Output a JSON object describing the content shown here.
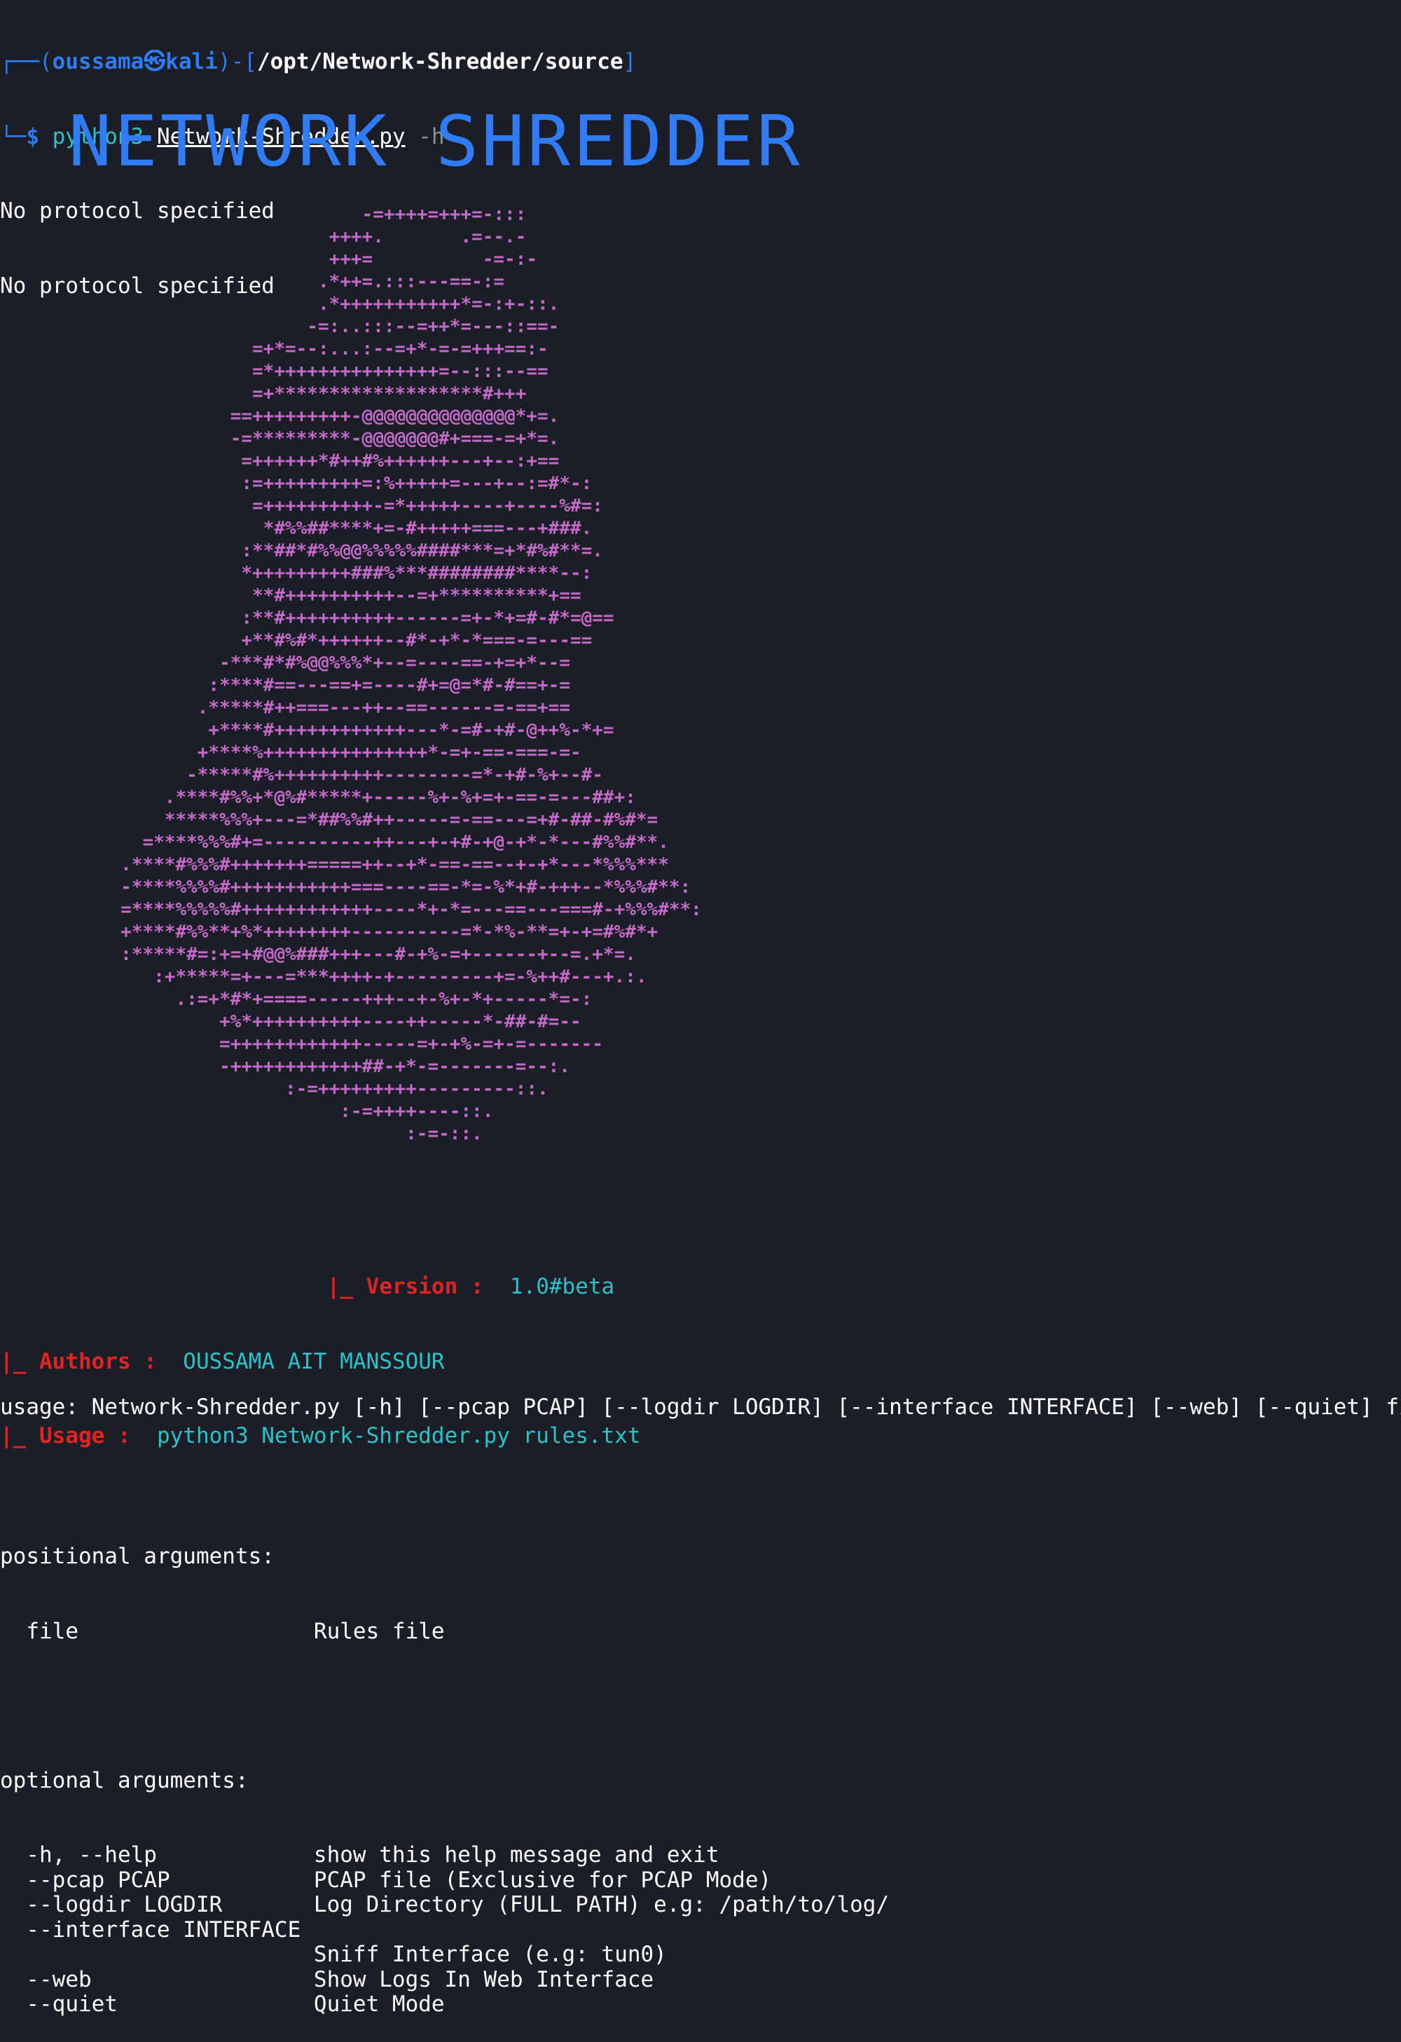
{
  "prompt": {
    "user_host": "oussama㉿kali",
    "cwd": "/opt/Network-Shredder/source",
    "cmd_prefix": "python3",
    "cmd_file": "Network-Shredder.py",
    "cmd_args": "-h"
  },
  "output_lines": [
    "No protocol specified",
    "No protocol specified"
  ],
  "banner_title": "NETWORK SHREDDER",
  "ascii_art": [
    "                                 -=++++=+++=-:::",
    "                              ++++.       .=--.-",
    "                              +++=          -=-:-",
    "                             .*++=.:::---==-:=",
    "                             .*+++++++++++*=-:+-::.",
    "                            -=:..:::--=++*=---::==-",
    "                       =+*=--:...:--=+*-=-=+++==:-",
    "                       =*+++++++++++++++=--:::--==",
    "                       =+*******************#+++",
    "                     ==+++++++++-@@@@@@@@@@@@@@*+=.",
    "                     -=*********-@@@@@@@#+===-=+*=.",
    "                      =++++++*#++#%++++++---+--:+==",
    "                      :=+++++++++=:%+++++=---+--:=#*-:",
    "                       =++++++++++-=*+++++----+----%#=:",
    "                        *#%%##****+=-#+++++===---+###.",
    "                      :**##*#%%@@%%%%%####***=+*#%#**=.",
    "                      *+++++++++###%***########****--:",
    "                       **#++++++++++--=+**********+==",
    "                      :**#++++++++++------=+-*+=#-#*=@==",
    "                      +**#%#*++++++--#*-+*-*===-=---==",
    "                    -***#*#%@@%%%*+--=----==-+=+*--=",
    "                   :****#==---==+=----#+=@=*#-#==+-=",
    "                  .*****#++===---++--==------=-==+==",
    "                   +****#++++++++++++---*-=#-+#-@++%-*+=",
    "                  +****%+++++++++++++++*-=+-==-===-=-",
    "                 -*****#%++++++++++--------=*-+#-%+--#-",
    "               .****#%%+*@%#*****+-----%+-%+=+-==-=---##+:",
    "               *****%%%+---=*##%%#++-----=-==---=+#-##-#%#*=",
    "             =****%%%#+=----------++---+-+#-+@-+*-*---#%%#**.",
    "           .****#%%%#+++++++=====++--+*-==-==--+-+*---*%%%***",
    "           -****%%%%#+++++++++++===----==-*=-%*+#-+++--*%%%#**:",
    "           =****%%%%%#++++++++++++----*+-*=---==---===#-+%%%#**:",
    "           +****#%%**+%*++++++++----------=*-*%-**=+-+=#%#*+",
    "           :*****#=:+=+#@@%###+++---#-+%-=+------+--=.+*=.",
    "              :+*****=+---=***++++-+---------+=-%++#---+.:.",
    "                .:=+*#*+====-----+++--+-%+-*+-----*=-:",
    "                    +%*++++++++++----++-----*-##-#=--",
    "                    =++++++++++++-----=+-+%-=+-=-------",
    "                    -++++++++++++##-+*-=-------=--:.",
    "                          :-=+++++++++---------::.",
    "                               :-=++++----::.",
    "                                     :-=-::."
  ],
  "version_label": "|_ Version :",
  "version_value": "1.0#beta",
  "authors_label": "|_ Authors :",
  "authors_value": "OUSSAMA AIT MANSSOUR",
  "usage_label": "|_ Usage :",
  "usage_value": "python3 Network-Shredder.py rules.txt",
  "help": {
    "usage": "usage: Network-Shredder.py [-h] [--pcap PCAP] [--logdir LOGDIR] [--interface INTERFACE] [--web] [--quiet] file",
    "positional_header": "positional arguments:",
    "positional": [
      {
        "flag": "file",
        "desc": "Rules file"
      }
    ],
    "optional_header": "optional arguments:",
    "optional": [
      {
        "flag": "-h, --help",
        "desc": "show this help message and exit"
      },
      {
        "flag": "--pcap PCAP",
        "desc": "PCAP file (Exclusive for PCAP Mode)"
      },
      {
        "flag": "--logdir LOGDIR",
        "desc": "Log Directory (FULL PATH) e.g: /path/to/log/"
      },
      {
        "flag": "--interface INTERFACE",
        "desc": ""
      },
      {
        "flag": "",
        "desc": "Sniff Interface (e.g: tun0)"
      },
      {
        "flag": "--web",
        "desc": "Show Logs In Web Interface"
      },
      {
        "flag": "--quiet",
        "desc": "Quiet Mode"
      }
    ]
  },
  "colors": {
    "background": "#1b1e26",
    "prompt": "#2f7cf6",
    "command": "#2ac3c9",
    "art": "#c46ac8",
    "label_red": "#e02424"
  }
}
